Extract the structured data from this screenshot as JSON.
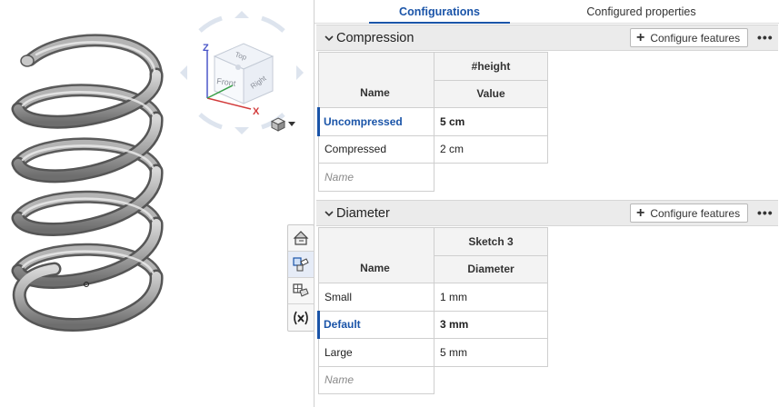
{
  "viewport": {
    "viewcube": {
      "top_label": "Top",
      "front_label": "Front",
      "right_label": "Right",
      "axis_x": "X",
      "axis_z": "Z"
    }
  },
  "tabs": [
    {
      "label": "Configurations",
      "active": true
    },
    {
      "label": "Configured properties",
      "active": false
    }
  ],
  "sections": [
    {
      "title": "Compression",
      "configure_label": "Configure features",
      "param_header": "#height",
      "name_header": "Name",
      "value_header": "Value",
      "rows": [
        {
          "name": "Uncompressed",
          "value": "5 cm",
          "selected": true
        },
        {
          "name": "Compressed",
          "value": "2 cm",
          "selected": false
        }
      ],
      "new_row_placeholder": "Name"
    },
    {
      "title": "Diameter",
      "configure_label": "Configure features",
      "param_header": "Sketch 3",
      "name_header": "Name",
      "value_header": "Diameter",
      "rows": [
        {
          "name": "Small",
          "value": "1 mm",
          "selected": false
        },
        {
          "name": "Default",
          "value": "3 mm",
          "selected": true
        },
        {
          "name": "Large",
          "value": "5 mm",
          "selected": false
        }
      ],
      "new_row_placeholder": "Name"
    }
  ],
  "colors": {
    "accent": "#1a54a8",
    "section_bg": "#ebebeb",
    "spring": "#9a9a9a"
  }
}
